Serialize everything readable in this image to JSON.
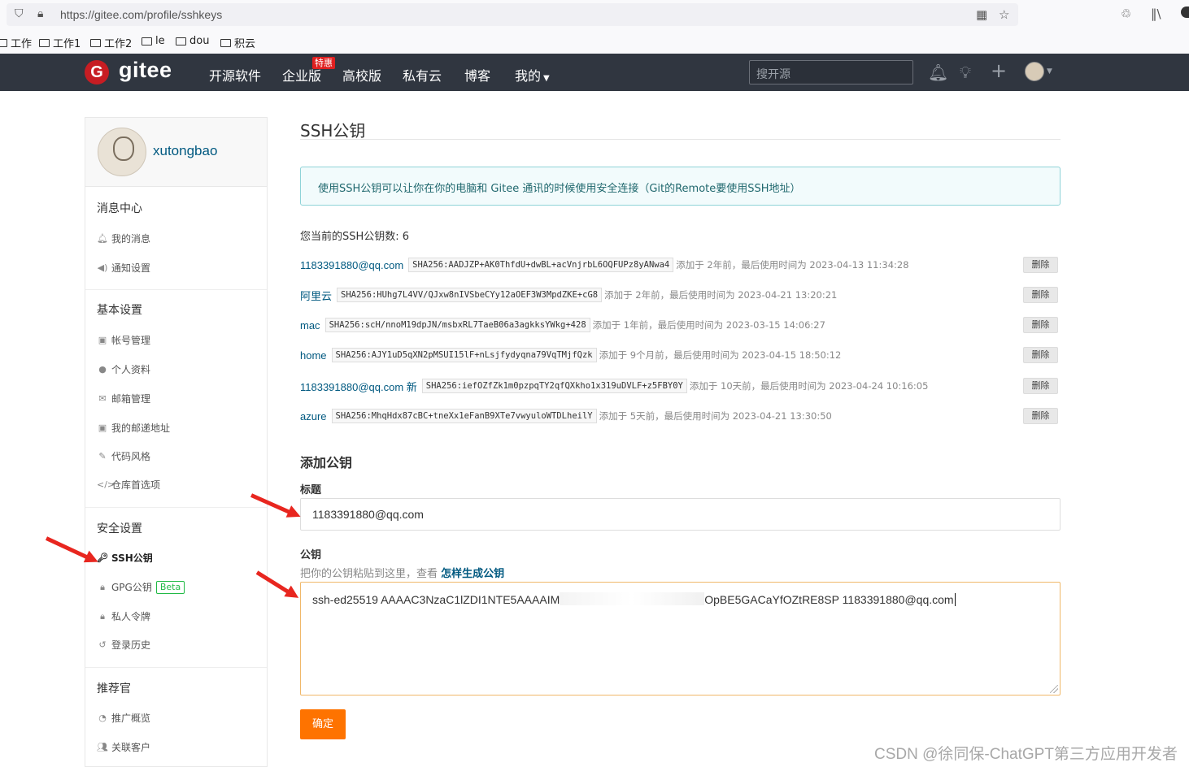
{
  "browser": {
    "url": "https://gitee.com/profile/sshkeys",
    "bookmarks": [
      "工作",
      "工作1",
      "工作2",
      "le",
      "dou",
      "积云"
    ]
  },
  "header": {
    "logo_letter": "G",
    "logo_text": "gitee",
    "nav": [
      "开源软件",
      "企业版",
      "高校版",
      "私有云",
      "博客",
      "我的"
    ],
    "badge": "特惠",
    "search_placeholder": "搜开源"
  },
  "sidebar": {
    "username": "xutongbao",
    "sections": [
      {
        "title": "消息中心",
        "items": [
          "我的消息",
          "通知设置"
        ]
      },
      {
        "title": "基本设置",
        "items": [
          "帐号管理",
          "个人资料",
          "邮箱管理",
          "我的邮递地址",
          "代码风格",
          "仓库首选项"
        ]
      },
      {
        "title": "安全设置",
        "items": [
          "SSH公钥",
          "GPG公钥",
          "私人令牌",
          "登录历史"
        ]
      },
      {
        "title": "推荐官",
        "items": [
          "推广概览",
          "关联客户"
        ]
      }
    ],
    "beta_label": "Beta"
  },
  "main": {
    "title": "SSH公钥",
    "info": "使用SSH公钥可以让你在你的电脑和 Gitee 通讯的时候使用安全连接（Git的Remote要使用SSH地址）",
    "count_text": "您当前的SSH公钥数: 6",
    "delete_label": "删除",
    "keys": [
      {
        "name": "1183391880@qq.com",
        "fingerprint": "SHA256:AADJZP+AK0ThfdU+dwBL+acVnjrbL6OQFUPz8yANwa4",
        "meta": "添加于 2年前，最后使用时间为 2023-04-13 11:34:28"
      },
      {
        "name": "阿里云",
        "fingerprint": "SHA256:HUhg7L4VV/QJxw8nIVSbeCYy12aOEF3W3MpdZKE+cG8",
        "meta": "添加于 2年前，最后使用时间为 2023-04-21 13:20:21"
      },
      {
        "name": "mac",
        "fingerprint": "SHA256:scH/nnoM19dpJN/msbxRL7TaeB06a3agkksYWkg+428",
        "meta": "添加于 1年前，最后使用时间为 2023-03-15 14:06:27"
      },
      {
        "name": "home",
        "fingerprint": "SHA256:AJY1uD5qXN2pMSUI15lF+nLsjfydyqna79VqTMjfQzk",
        "meta": "添加于 9个月前，最后使用时间为 2023-04-15 18:50:12"
      },
      {
        "name": "1183391880@qq.com 新",
        "fingerprint": "SHA256:iefOZfZk1m0pzpqTY2qfQXkho1x319uDVLF+z5FBY0Y",
        "meta": "添加于 10天前，最后使用时间为 2023-04-24 10:16:05"
      },
      {
        "name": "azure",
        "fingerprint": "SHA256:MhqHdx87cBC+tneXx1eFanB9XTe7vwyuloWTDLheilY",
        "meta": "添加于 5天前，最后使用时间为 2023-04-21 13:30:50"
      }
    ],
    "add_title": "添加公钥",
    "title_label": "标题",
    "title_value": "1183391880@qq.com",
    "key_label": "公钥",
    "hint_text": "把你的公钥粘贴到这里，查看",
    "hint_link": "怎样生成公钥",
    "key_value_start": "ssh-ed25519 AAAAC3NzaC1lZDI1NTE5AAAAIM",
    "key_value_end": "OpBE5GACaYfOZtRE8SP 1183391880@qq.com",
    "submit": "确定"
  },
  "watermark": "CSDN @徐同保-ChatGPT第三方应用开发者",
  "colors": {
    "header_bg": "#303640",
    "brand_red": "#c71d23",
    "submit_orange": "#fe7300",
    "link_blue": "#005980"
  }
}
